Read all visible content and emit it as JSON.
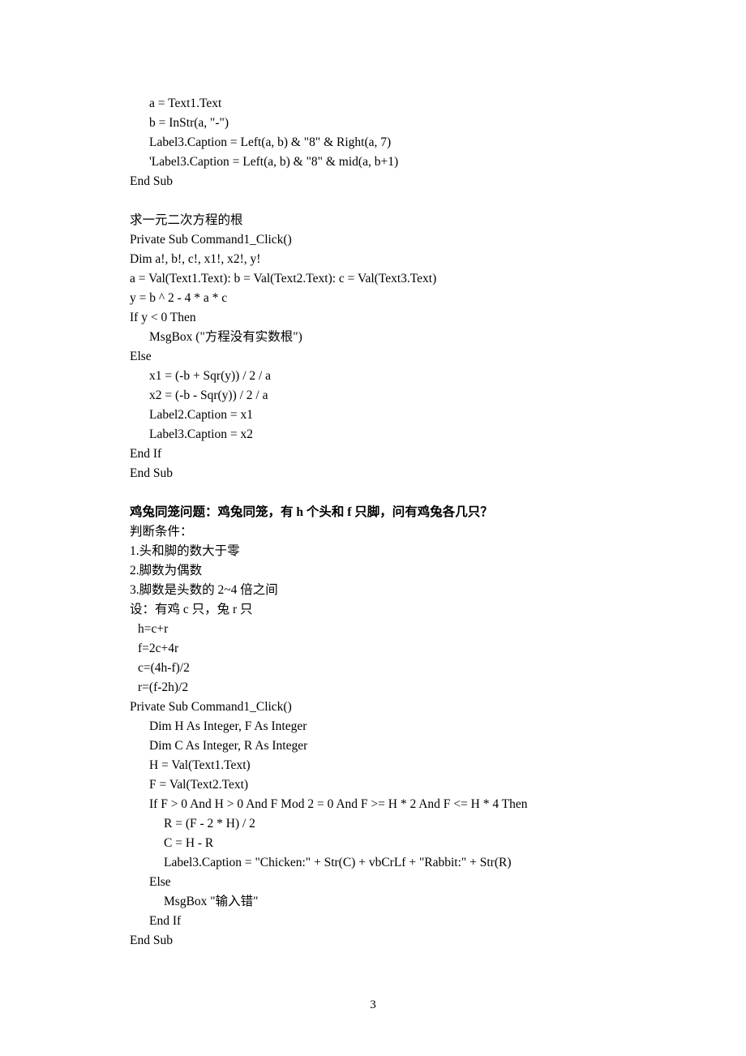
{
  "block1": {
    "l1": "a = Text1.Text",
    "l2": "b = InStr(a, \"-\")",
    "l3": "Label3.Caption = Left(a, b) & \"8\" & Right(a, 7)",
    "l4": "'Label3.Caption = Left(a, b) & \"8\" & mid(a, b+1)",
    "l5": "End Sub"
  },
  "block2": {
    "title": "求一元二次方程的根",
    "l1": "Private Sub Command1_Click()",
    "l2": "Dim a!, b!, c!, x1!, x2!, y!",
    "l3": "a = Val(Text1.Text): b = Val(Text2.Text): c = Val(Text3.Text)",
    "l4": "y = b ^ 2 - 4 * a * c",
    "l5": "If y < 0 Then",
    "l6": "MsgBox (\"方程没有实数根\")",
    "l7": "Else",
    "l8": "x1 = (-b + Sqr(y)) / 2 / a",
    "l9": "x2 = (-b - Sqr(y)) / 2 / a",
    "l10": "Label2.Caption = x1",
    "l11": "Label3.Caption = x2",
    "l12": "End If",
    "l13": "End Sub"
  },
  "block3": {
    "title": "鸡兔同笼问题：鸡兔同笼，有 h 个头和 f 只脚，问有鸡兔各几只？",
    "l1": "判断条件：",
    "l2": "1.头和脚的数大于零",
    "l3": "2.脚数为偶数",
    "l4": "3.脚数是头数的 2~4 倍之间",
    "l5": "设：有鸡 c 只，兔 r 只",
    "l6": "h=c+r",
    "l7": "f=2c+4r",
    "l8": "c=(4h-f)/2",
    "l9": "r=(f-2h)/2",
    "l10": "Private Sub Command1_Click()",
    "l11": "Dim H As Integer, F As Integer",
    "l12": "Dim C As Integer, R As Integer",
    "l13": "H = Val(Text1.Text)",
    "l14": "F = Val(Text2.Text)",
    "l15": "If F > 0 And H > 0 And F Mod 2 = 0 And F >= H * 2 And F <= H * 4 Then",
    "l16": "R = (F - 2 * H) / 2",
    "l17": "C = H - R",
    "l18": "Label3.Caption = \"Chicken:\" + Str(C) + vbCrLf + \"Rabbit:\" + Str(R)",
    "l19": "Else",
    "l20": "MsgBox \"输入错\"",
    "l21": "End If",
    "l22": "End Sub"
  },
  "pageNumber": "3"
}
